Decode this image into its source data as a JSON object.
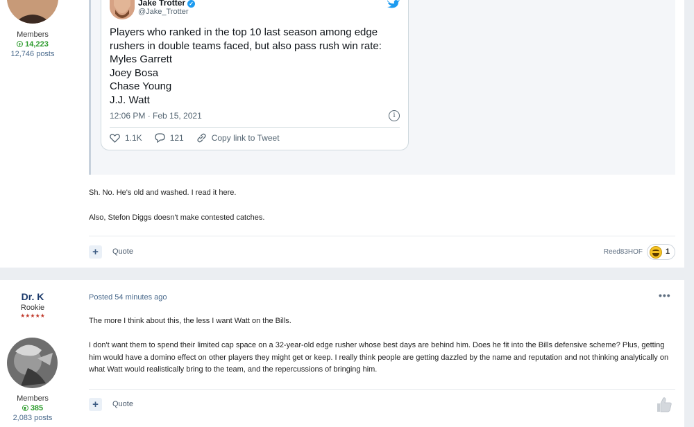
{
  "post1": {
    "author": {
      "group": "Members",
      "reputation": "14,223",
      "post_count": "12,746 posts"
    },
    "tweet": {
      "name": "Jake Trotter",
      "handle": "@Jake_Trotter",
      "text_lines": [
        "Players who ranked in the top 10 last season among edge",
        "rushers in double teams faced, but also pass rush win rate:",
        "Myles Garrett",
        "Joey Bosa",
        "Chase Young",
        "J.J. Watt"
      ],
      "timestamp": "12:06 PM · Feb 15, 2021",
      "likes": "1.1K",
      "replies": "121",
      "copy_link": "Copy link to Tweet",
      "brand_color": "#1d9bf0"
    },
    "paragraphs": [
      "Sh. No. He's old and washed. I read it here.",
      "Also, Stefon Diggs doesn't make contested catches."
    ],
    "quote_label": "Quote",
    "reaction": {
      "user": "Reed83HOF",
      "emoji": "laughing-face-icon",
      "count": "1"
    }
  },
  "post2": {
    "author": {
      "name": "Dr. K",
      "rank": "Rookie",
      "stars": "★★★★★",
      "group": "Members",
      "reputation": "385",
      "post_count": "2,083 posts"
    },
    "posted": "Posted 54 minutes ago",
    "more": "•••",
    "paragraphs": [
      "The more I think about this, the less I want Watt on the Bills.",
      "I don't want them to spend their limited cap space on a 32-year-old edge rusher whose best days are behind him. Does he fit into the Bills defensive scheme? Plus, getting him would have a domino effect on other players they might get or keep. I really think people are getting dazzled by the name and reputation and not thinking analytically on what Watt would realistically bring to the team, and the repercussions of bringing him."
    ],
    "quote_label": "Quote"
  },
  "colors": {
    "reputation": "#2a9a2a",
    "author_name": "#1b3a6b",
    "stars": "#c0392b"
  }
}
